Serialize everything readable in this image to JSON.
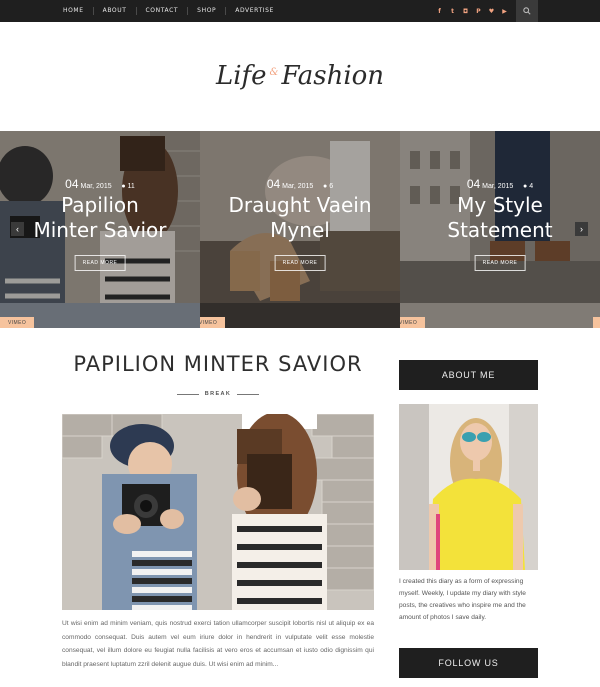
{
  "nav": {
    "items": [
      "HOME",
      "ABOUT",
      "CONTACT",
      "SHOP",
      "ADVERTISE"
    ],
    "social_icons": [
      "facebook-icon",
      "twitter-icon",
      "instagram-icon",
      "pinterest-icon",
      "heart-icon",
      "youtube-icon"
    ],
    "social_glyphs": [
      "f",
      "t",
      "◘",
      "P",
      "♥",
      "▶"
    ],
    "search_icon": "search-icon"
  },
  "logo": {
    "word1": "Life",
    "amp": "&",
    "word2": "Fashion"
  },
  "slider": {
    "slides": [
      {
        "day": "04",
        "month": "Mar, 2015",
        "comments": "11",
        "title_line1": "Papilion",
        "title_line2": "Minter Savior",
        "read_more": "READ MORE",
        "tag": "VIMEO"
      },
      {
        "day": "04",
        "month": "Mar, 2015",
        "comments": "6",
        "title_line1": "Draught Vaein",
        "title_line2": "Mynel",
        "read_more": "READ MORE",
        "tag": "VIMEO"
      },
      {
        "day": "04",
        "month": "Mar, 2015",
        "comments": "4",
        "title_line1": "My Style",
        "title_line2": "Statement",
        "read_more": "READ MORE",
        "tag": "VIMEO"
      }
    ],
    "prev_glyph": "‹",
    "next_glyph": "›"
  },
  "post": {
    "title": "PAPILION MINTER SAVIOR",
    "category": "BREAK",
    "excerpt": "Ut wisi enim ad minim veniam, quis nostrud exerci tation ullamcorper suscipit lobortis nisl ut aliquip ex ea commodo consequat. Duis autem vel eum iriure dolor in hendrerit in vulputate velit esse molestie consequat, vel illum dolore eu feugiat nulla facilisis at vero eros et accumsan et iusto odio dignissim qui blandit praesent luptatum zzril delenit augue duis. Ut wisi enim ad minim..."
  },
  "sidebar": {
    "about_title": "ABOUT ME",
    "about_text": "I created this diary as a form of expressing myself. Weekly, I update my diary with style posts, the creatives who inspire me and the amount of photos I save daily.",
    "follow_title": "FOLLOW US"
  },
  "colors": {
    "accent": "#f2a381",
    "tag": "#f6c39d",
    "dark": "#1f1f1f"
  }
}
